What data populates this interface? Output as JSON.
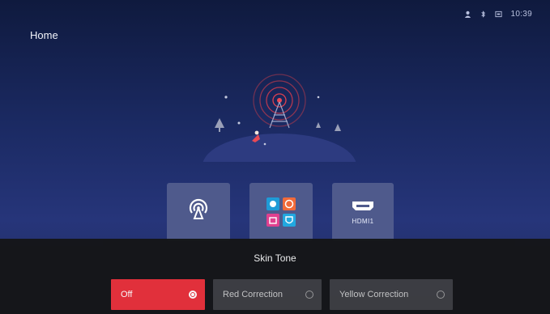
{
  "status_bar": {
    "time": "10:39",
    "icons": [
      "user-icon",
      "bluetooth-icon",
      "input-icon"
    ]
  },
  "page": {
    "title": "Home"
  },
  "tiles": [
    {
      "name": "cast",
      "icon": "cast-icon",
      "label": ""
    },
    {
      "name": "apps",
      "icon": "apps-grid-icon",
      "label": ""
    },
    {
      "name": "hdmi",
      "icon": "hdmi-icon",
      "label": "HDMI1"
    }
  ],
  "skin_tone_menu": {
    "title": "Skin Tone",
    "options": [
      {
        "label": "Off",
        "selected": true
      },
      {
        "label": "Red Correction",
        "selected": false
      },
      {
        "label": "Yellow Correction",
        "selected": false
      }
    ]
  },
  "colors": {
    "selected_accent": "#e8313a",
    "tile_bg": "#4f5a8c",
    "overlay_bg": "#151618"
  }
}
